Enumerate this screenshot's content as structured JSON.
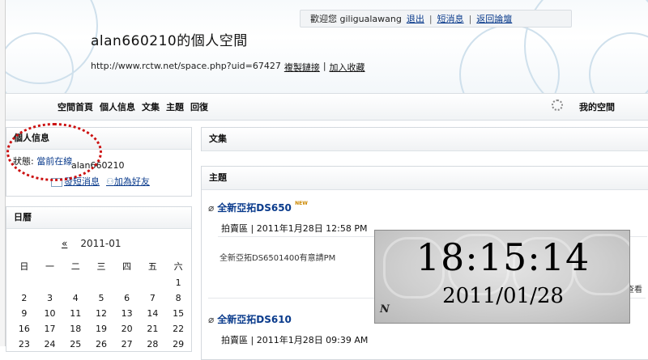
{
  "header": {
    "welcome": "歡迎您 giligualawang",
    "logout": "退出",
    "messages": "短消息",
    "back_forum": "返回論壇",
    "title": "alan660210的個人空間",
    "url": "http://www.rctw.net/space.php?uid=67427",
    "copy_link": "複製鏈接",
    "add_fav": "加入收藏"
  },
  "nav": {
    "items": [
      "空間首頁",
      "個人信息",
      "文集",
      "主題",
      "回復"
    ],
    "my_space": "我的空間",
    "icon": "gear-icon"
  },
  "profile": {
    "heading": "個人信息",
    "status_label": "狀態:",
    "status_value": "當前在線",
    "username": "alan660210",
    "send_msg": "發短消息",
    "add_friend": "加為好友"
  },
  "calendar": {
    "heading": "日曆",
    "prev": "«",
    "month": "2011-01",
    "weekdays": [
      "日",
      "一",
      "二",
      "三",
      "四",
      "五",
      "六"
    ],
    "rows": [
      [
        "",
        "",
        "",
        "",
        "",
        "",
        "1"
      ],
      [
        "2",
        "3",
        "4",
        "5",
        "6",
        "7",
        "8"
      ],
      [
        "9",
        "10",
        "11",
        "12",
        "13",
        "14",
        "15"
      ],
      [
        "16",
        "17",
        "18",
        "19",
        "20",
        "21",
        "22"
      ],
      [
        "23",
        "24",
        "25",
        "26",
        "27",
        "28",
        "29"
      ]
    ]
  },
  "articles": {
    "heading": "文集"
  },
  "topics": {
    "heading": "主題",
    "posts": [
      {
        "title": "全新亞拓DS650",
        "badge": "NEW",
        "meta": "拍賣區 | 2011年1月28日 12:58 PM",
        "excerpt": "全新亞拓DS6501400有意請PM",
        "more": "查看"
      },
      {
        "title": "全新亞拓DS610",
        "meta": "拍賣區 | 2011年1月28日 09:39 AM"
      }
    ]
  },
  "clock": {
    "time": "18:15:14",
    "date": "2011/01/28",
    "mark": "N"
  }
}
